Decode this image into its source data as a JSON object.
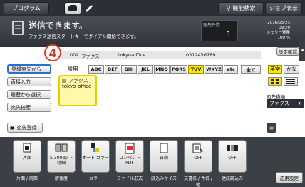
{
  "topbar": {
    "program_label": "プログラム",
    "func_search_label": "機能検索",
    "job_display_label": "ジョブ表示"
  },
  "header": {
    "title": "送信できます。",
    "subtitle": "ファクス送信スタートキーでダイアル開始できます。",
    "dest_count_label": "宛先件数",
    "dest_count": "1",
    "date": "2016/05/23",
    "time": "09:20",
    "memory_label": "メモリー残量",
    "memory_value": "100 %",
    "settings_label": "設定確認"
  },
  "address_strip": {
    "number": "002",
    "type": "ファクス",
    "name": "tokyo-office",
    "fax_number": "0312456789"
  },
  "marker": "4",
  "left_menu": [
    {
      "label": "登録宛先から"
    },
    {
      "label": "直接入力"
    },
    {
      "label": "履歴から選択"
    },
    {
      "label": "宛先検索"
    }
  ],
  "register_label": "宛先登録",
  "index": {
    "frequent_label": "常用",
    "tabs": [
      "ABC",
      "DEF",
      "GHI",
      "JKL",
      "MNO",
      "PQRS",
      "TUV",
      "WXYZ",
      "etc",
      "全て"
    ],
    "english_label": "英字",
    "kana_label": "かな"
  },
  "entry": {
    "type": "ファクス",
    "name": "tokyo-office"
  },
  "dest_type": {
    "label": "宛先種類",
    "value": "ファクス"
  },
  "toolbar": {
    "tools": [
      {
        "label": "片面",
        "caption": "片面 / 両面"
      },
      {
        "label": "S 300dpi F 精細",
        "caption": "解像度"
      },
      {
        "label": "オート カラー",
        "caption": "カラー"
      },
      {
        "label": "コンパクト PDF",
        "caption": "ファイル形式"
      },
      {
        "label": "自動",
        "caption": "読込みサイズ"
      },
      {
        "label": "OFF",
        "caption": "文書名 / 件名 / 他"
      },
      {
        "label": "OFF",
        "caption": "連続読込み"
      }
    ],
    "apply_label": "応用設定"
  }
}
